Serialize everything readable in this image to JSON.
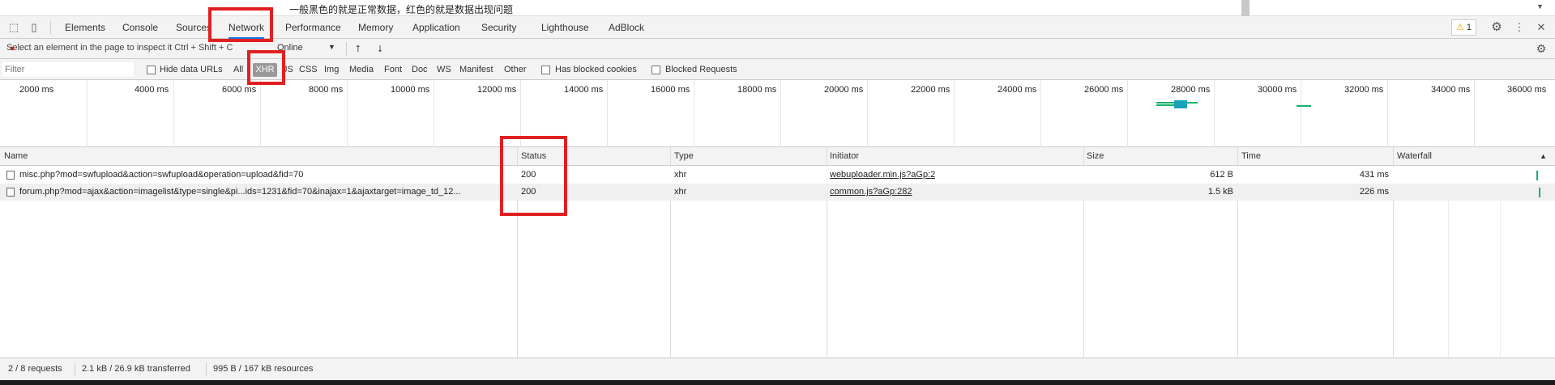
{
  "page": {
    "text": "一般黑色的就是正常数据，红色的就是数据出现问题"
  },
  "tabs": [
    {
      "label": "Elements",
      "active": false
    },
    {
      "label": "Console",
      "active": false
    },
    {
      "label": "Sources",
      "active": false
    },
    {
      "label": "Network",
      "active": true
    },
    {
      "label": "Performance",
      "active": false
    },
    {
      "label": "Memory",
      "active": false
    },
    {
      "label": "Application",
      "active": false
    },
    {
      "label": "Security",
      "active": false
    },
    {
      "label": "Lighthouse",
      "active": false
    },
    {
      "label": "AdBlock",
      "active": false
    }
  ],
  "tabbar": {
    "warning_count": "1",
    "warning_icon": "warning-icon",
    "settings_icon": "gear-icon",
    "more_icon": "kebab-icon",
    "close_icon": "close-icon"
  },
  "toolbar": {
    "inspect_hint": "Select an element in the page to inspect it  Ctrl + Shift + C",
    "throttle": "Online",
    "upload_icon": "upload-icon",
    "download_icon": "download-icon"
  },
  "filters": {
    "placeholder": "Filter",
    "hide_data_urls": "Hide data URLs",
    "types": [
      "All",
      "XHR",
      "JS",
      "CSS",
      "Img",
      "Media",
      "Font",
      "Doc",
      "WS",
      "Manifest",
      "Other"
    ],
    "selected_type": "XHR",
    "has_blocked_cookies": "Has blocked cookies",
    "blocked_requests": "Blocked Requests"
  },
  "overview": {
    "ticks": [
      "2000 ms",
      "4000 ms",
      "6000 ms",
      "8000 ms",
      "10000 ms",
      "12000 ms",
      "14000 ms",
      "16000 ms",
      "18000 ms",
      "20000 ms",
      "22000 ms",
      "24000 ms",
      "26000 ms",
      "28000 ms",
      "30000 ms",
      "32000 ms",
      "34000 ms",
      "36000 ms"
    ]
  },
  "table": {
    "columns": {
      "name": "Name",
      "status": "Status",
      "type": "Type",
      "initiator": "Initiator",
      "size": "Size",
      "time": "Time",
      "waterfall": "Waterfall"
    },
    "rows": [
      {
        "name": "misc.php?mod=swfupload&action=swfupload&operation=upload&fid=70",
        "status": "200",
        "type": "xhr",
        "initiator": "webuploader.min.js?aGp:2",
        "size": "612 B",
        "time": "431 ms"
      },
      {
        "name": "forum.php?mod=ajax&action=imagelist&type=single&pi...ids=1231&fid=70&inajax=1&ajaxtarget=image_td_12...",
        "status": "200",
        "type": "xhr",
        "initiator": "common.js?aGp:282",
        "size": "1.5 kB",
        "time": "226 ms"
      }
    ]
  },
  "status": {
    "requests": "2 / 8 requests",
    "transferred": "2.1 kB / 26.9 kB transferred",
    "resources": "995 B / 167 kB resources"
  },
  "colors": {
    "accent": "#1a73e8",
    "annotation": "#e02020",
    "waterfall": "#13b26b"
  }
}
